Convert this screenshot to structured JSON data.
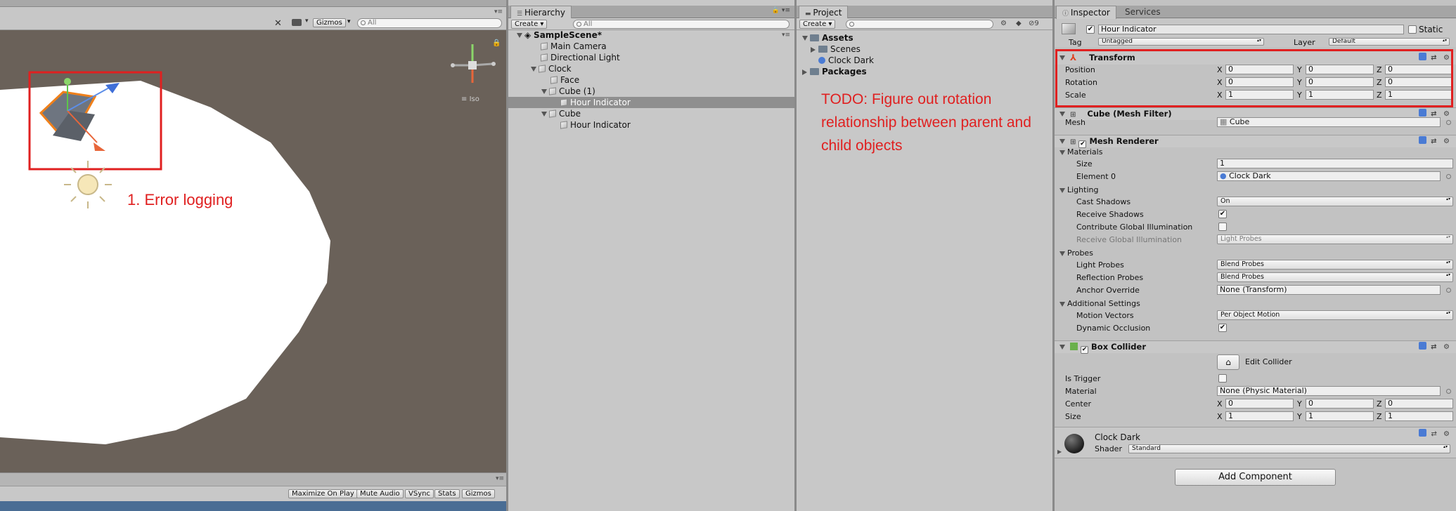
{
  "scene": {
    "gizmos_label": "Gizmos",
    "search_placeholder": "All",
    "iso_label": "Iso",
    "bottom_buttons": [
      "Maximize On Play",
      "Mute Audio",
      "VSync",
      "Stats",
      "Gizmos"
    ],
    "annotation": "1. Error logging"
  },
  "hierarchy": {
    "tab_label": "Hierarchy",
    "create_label": "Create",
    "search_placeholder": "All",
    "items": [
      {
        "label": "SampleScene*",
        "depth": 0
      },
      {
        "label": "Main Camera",
        "depth": 1
      },
      {
        "label": "Directional Light",
        "depth": 1
      },
      {
        "label": "Clock",
        "depth": 1
      },
      {
        "label": "Face",
        "depth": 2
      },
      {
        "label": "Cube (1)",
        "depth": 2
      },
      {
        "label": "Hour Indicator",
        "depth": 3
      },
      {
        "label": "Cube",
        "depth": 2
      },
      {
        "label": "Hour Indicator",
        "depth": 3
      }
    ]
  },
  "project": {
    "tab_label": "Project",
    "create_label": "Create",
    "count_label": "9",
    "items": [
      "Assets",
      "Scenes",
      "Clock Dark",
      "Packages"
    ],
    "annotation": "TODO: Figure out rotation relationship between parent and child objects"
  },
  "inspector": {
    "tab_label": "Inspector",
    "services_label": "Services",
    "object_name": "Hour Indicator",
    "static_label": "Static",
    "tag_label": "Tag",
    "tag_value": "Untagged",
    "layer_label": "Layer",
    "layer_value": "Default",
    "transform": {
      "title": "Transform",
      "rows": [
        {
          "label": "Position",
          "x": "0",
          "y": "0",
          "z": "0"
        },
        {
          "label": "Rotation",
          "x": "0",
          "y": "0",
          "z": "0"
        },
        {
          "label": "Scale",
          "x": "1",
          "y": "1",
          "z": "1"
        }
      ]
    },
    "mesh_filter": {
      "title": "Cube (Mesh Filter)",
      "mesh_label": "Mesh",
      "mesh_value": "Cube"
    },
    "mesh_renderer": {
      "title": "Mesh Renderer",
      "materials_label": "Materials",
      "size_label": "Size",
      "size_value": "1",
      "element0_label": "Element 0",
      "element0_value": "Clock Dark",
      "lighting_label": "Lighting",
      "cast_shadows_label": "Cast Shadows",
      "cast_shadows_value": "On",
      "receive_shadows_label": "Receive Shadows",
      "contribute_gi_label": "Contribute Global Illumination",
      "receive_gi_label": "Receive Global Illumination",
      "receive_gi_value": "Light Probes",
      "probes_label": "Probes",
      "light_probes_label": "Light Probes",
      "light_probes_value": "Blend Probes",
      "reflection_probes_label": "Reflection Probes",
      "reflection_probes_value": "Blend Probes",
      "anchor_override_label": "Anchor Override",
      "anchor_override_value": "None (Transform)",
      "additional_label": "Additional Settings",
      "motion_vectors_label": "Motion Vectors",
      "motion_vectors_value": "Per Object Motion",
      "dynamic_occlusion_label": "Dynamic Occlusion"
    },
    "box_collider": {
      "title": "Box Collider",
      "edit_label": "Edit Collider",
      "is_trigger_label": "Is Trigger",
      "material_label": "Material",
      "material_value": "None (Physic Material)",
      "center_label": "Center",
      "center": {
        "x": "0",
        "y": "0",
        "z": "0"
      },
      "size_label": "Size",
      "size": {
        "x": "1",
        "y": "1",
        "z": "1"
      }
    },
    "material": {
      "name": "Clock Dark",
      "shader_label": "Shader",
      "shader_value": "Standard"
    },
    "add_component_label": "Add Component"
  },
  "colors": {
    "annotation": "#e02020",
    "scene_bg": "#6a6159",
    "selection": "#8f8f8f"
  }
}
